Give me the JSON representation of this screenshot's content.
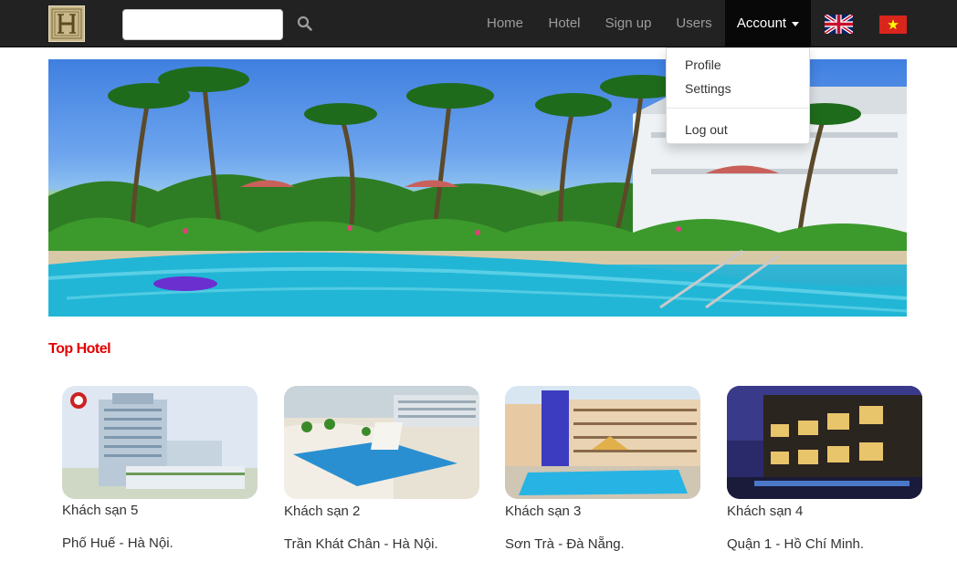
{
  "search": {
    "placeholder": "",
    "value": ""
  },
  "nav": {
    "items": [
      {
        "label": "Home"
      },
      {
        "label": "Hotel"
      },
      {
        "label": "Sign up"
      },
      {
        "label": "Users"
      }
    ],
    "account_label": "Account",
    "languages": [
      {
        "icon": "uk-flag-icon"
      },
      {
        "icon": "vietnam-flag-icon"
      }
    ]
  },
  "account_menu": {
    "items": [
      {
        "label": "Profile"
      },
      {
        "label": "Settings"
      }
    ],
    "logout_label": "Log out"
  },
  "section": {
    "title": "Top Hotel",
    "title_color": "#e50000"
  },
  "hotels": [
    {
      "name": "Khách sạn 5",
      "address": "Phố Huế - Hà Nội."
    },
    {
      "name": "Khách sạn 2",
      "address": "Trần Khát Chân - Hà Nội."
    },
    {
      "name": "Khách sạn 3",
      "address": "Sơn Trà - Đà Nẵng."
    },
    {
      "name": "Khách sạn 4",
      "address": "Quận 1 - Hồ Chí Minh."
    }
  ],
  "colors": {
    "navbar": "#222222",
    "nav_link": "#9d9d9d",
    "active_bg": "#080808"
  }
}
